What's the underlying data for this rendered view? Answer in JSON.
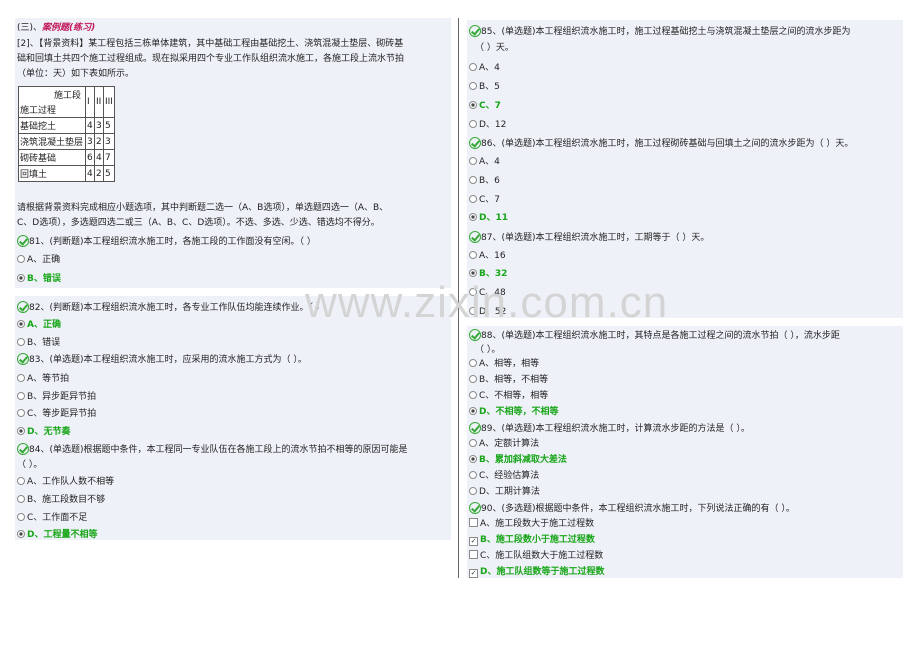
{
  "section": {
    "prefix": "(三)、",
    "emphasis": "案例题(练习)"
  },
  "case": {
    "line1": "[2]、【背景资料】某工程包括三栋单体建筑，其中基础工程由基础挖土、浇筑混凝土垫层、砌砖基",
    "line2": "础和回填土共四个施工过程组成。现在拟采用四个专业工作队组织流水施工，各施工段上流水节拍",
    "line3": "（单位：天）如下表如所示。",
    "table": {
      "header_top": "施工段",
      "header_bottom": "施工过程",
      "cols": [
        "I",
        "II",
        "III"
      ],
      "rows": [
        {
          "name": "基础挖土",
          "v": [
            "4",
            "3",
            "5"
          ]
        },
        {
          "name": "浇筑混凝土垫层",
          "v": [
            "3",
            "2",
            "3"
          ]
        },
        {
          "name": "砌砖基础",
          "v": [
            "6",
            "4",
            "7"
          ]
        },
        {
          "name": "回填土",
          "v": [
            "4",
            "2",
            "5"
          ]
        }
      ]
    },
    "instr1": "请根据背景资料完成相应小题选项，其中判断题二选一（A、B选项），单选题四选一（A、B、",
    "instr2": "C、D选项），多选题四选二或三（A、B、C、D选项）。不选、多选、少选、错选均不得分。"
  },
  "q81": {
    "stem": "81、(判断题)本工程组织流水施工时，各施工段的工作面没有空闲。（ ）",
    "a": "A、正确",
    "b": "B、错误"
  },
  "q82": {
    "stem": "82、(判断题)本工程组织流水施工时，各专业工作队伍均能连续作业。（ ）",
    "a": "A、正确",
    "b": "B、错误"
  },
  "q83": {
    "stem": "83、(单选题)本工程组织流水施工时，应采用的流水施工方式为（ ）。",
    "a": "A、等节拍",
    "b": "B、异步距异节拍",
    "c": "C、等步距异节拍",
    "d": "D、无节奏"
  },
  "q84": {
    "stem1": "84、(单选题)根据题中条件，本工程同一专业队伍在各施工段上的流水节拍不相等的原因可能是",
    "stem2": "（ ）。",
    "a": "A、工作队人数不相等",
    "b": "B、施工段数目不够",
    "c": "C、工作面不足",
    "d": "D、工程量不相等"
  },
  "q85": {
    "stem1": "85、(单选题)本工程组织流水施工时，施工过程基础挖土与浇筑混凝土垫层之间的流水步距为",
    "stem2": "（ ）天。",
    "a": "A、4",
    "b": "B、5",
    "c": "C、7",
    "d": "D、12"
  },
  "q86": {
    "stem": "86、(单选题)本工程组织流水施工时，施工过程砌砖基础与回填土之间的流水步距为（ ）天。",
    "a": "A、4",
    "b": "B、6",
    "c": "C、7",
    "d": "D、11"
  },
  "q87": {
    "stem": "87、(单选题)本工程组织流水施工时，工期等于（ ）天。",
    "a": "A、16",
    "b": "B、32",
    "c": "C、48",
    "d": "D、52"
  },
  "q88": {
    "stem1": "88、(单选题)本工程组织流水施工时，其特点是各施工过程之间的流水节拍（ ），流水步距",
    "stem2": "（ ）。",
    "a": "A、相等，相等",
    "b": "B、相等，不相等",
    "c": "C、不相等，相等",
    "d": "D、不相等，不相等"
  },
  "q89": {
    "stem": "89、(单选题)本工程组织流水施工时，计算流水步距的方法是（ ）。",
    "a": "A、定额计算法",
    "b": "B、累加斜减取大差法",
    "c": "C、经验估算法",
    "d": "D、工期计算法"
  },
  "q90": {
    "stem": "90、(多选题)根据题中条件，本工程组织流水施工时，下列说法正确的有（ ）。",
    "a": "A、施工段数大于施工过程数",
    "b": "B、施工段数小于施工过程数",
    "c": "C、施工队组数大于施工过程数",
    "d": "D、施工队组数等于施工过程数"
  },
  "watermark": "www.zixin.com.cn",
  "colors": {
    "panel": "#eef2f8",
    "answer": "#18a518",
    "check": "#36a836",
    "title": "#c2185b"
  }
}
